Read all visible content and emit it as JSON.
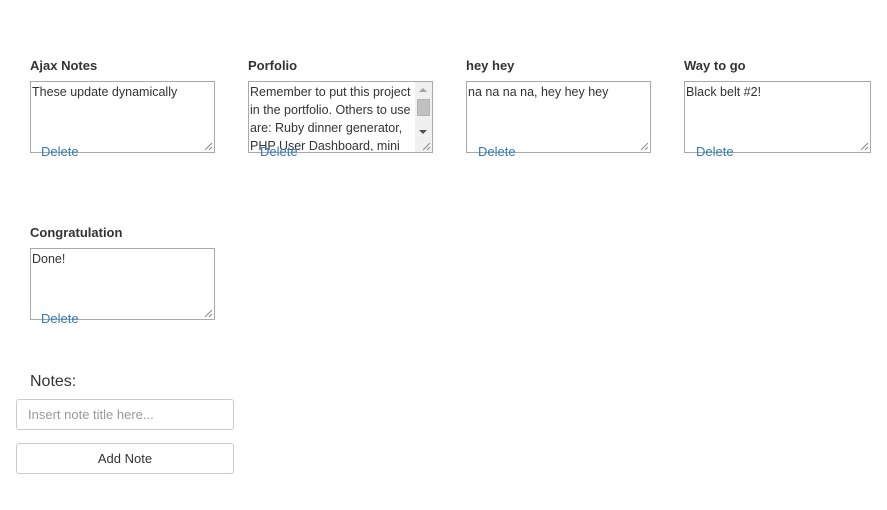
{
  "notes": [
    {
      "title": "Ajax Notes",
      "body": "These update dynamically",
      "delete_label": "Delete"
    },
    {
      "title": "Porfolio",
      "body": "Remember to put this project in the portfolio. Others to use are: Ruby dinner generator, PHP User Dashboard, mini",
      "delete_label": "Delete"
    },
    {
      "title": "hey hey",
      "body": "na na na na, hey hey hey",
      "delete_label": "Delete"
    },
    {
      "title": "Way to go",
      "body": "Black belt #2!",
      "delete_label": "Delete"
    },
    {
      "title": "Congratulation",
      "body": "Done!",
      "delete_label": "Delete"
    }
  ],
  "new_note": {
    "section_label": "Notes:",
    "title_placeholder": "Insert note title here...",
    "add_label": "Add Note"
  },
  "icons": {
    "resize": "resize-grip-icon",
    "scroll_up": "scroll-up-arrow-icon",
    "scroll_down": "scroll-down-arrow-icon"
  },
  "colors": {
    "link": "#337ab7",
    "text": "#333333",
    "border": "#cccccc"
  }
}
